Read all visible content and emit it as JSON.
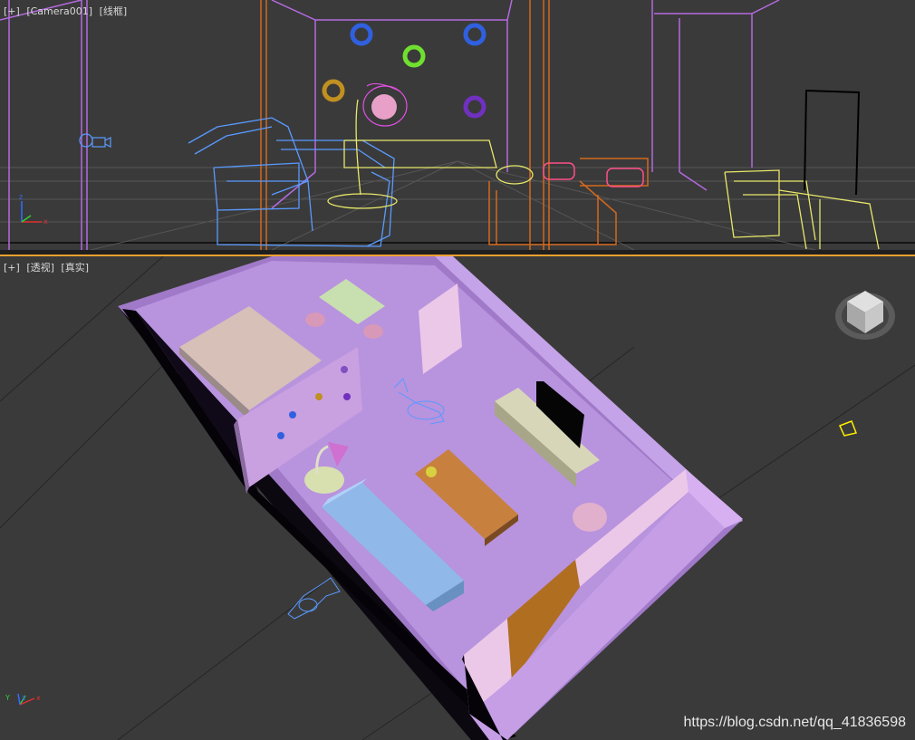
{
  "viewport_top": {
    "menu_plus": "[+]",
    "camera": "[Camera001]",
    "shading": "[线框]"
  },
  "viewport_bottom": {
    "menu_plus": "[+]",
    "view": "[透视]",
    "shading": "[真实]"
  },
  "watermark": "https://blog.csdn.net/qq_41836598",
  "colors": {
    "viewport_bg": "#3a3a3a",
    "room_floor": "#b995dd",
    "room_wall": "#c9a6ea",
    "active_border": "#f0a030"
  },
  "icons": [
    "viewcube-icon",
    "camera-icon",
    "axis-tripod-icon",
    "light-icon"
  ]
}
